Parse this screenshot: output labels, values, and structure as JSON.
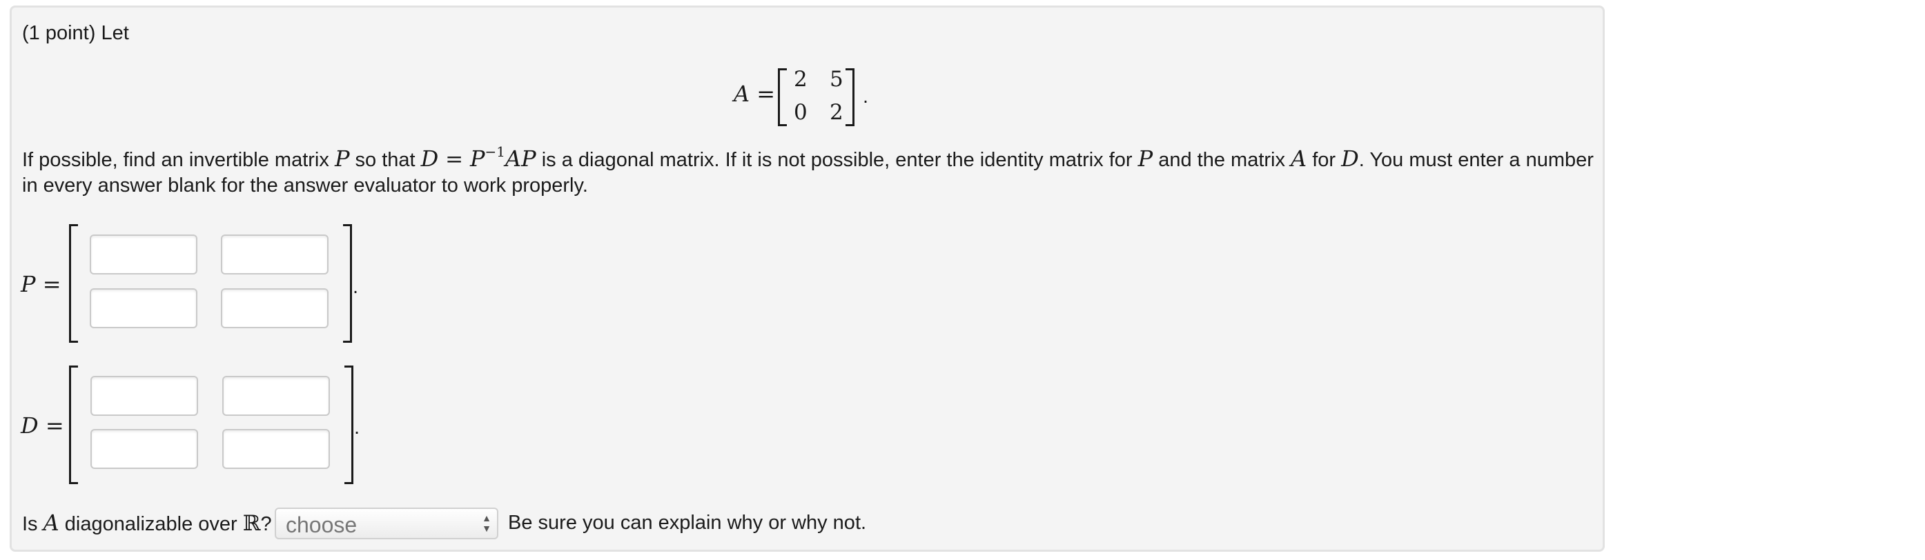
{
  "problem": {
    "intro": "(1 point) Let",
    "matrix_A": {
      "label": "A =",
      "rows": [
        [
          "2",
          "5"
        ],
        [
          "0",
          "2"
        ]
      ],
      "end": "."
    },
    "instructions": {
      "t1": "If possible, find an invertible matrix ",
      "P": "P",
      "t2": " so that ",
      "eq_D": "D",
      "eq_eq": " = ",
      "eq_P": "P",
      "eq_exp": "−1",
      "eq_AP": "AP",
      "t3": " is a diagonal matrix. If it is not possible, enter the identity matrix for ",
      "P2": "P",
      "t4": " and the matrix ",
      "A": "A",
      "t5": " for ",
      "D": "D",
      "t6": ". You must enter a number",
      "line2": "in every answer blank for the answer evaluator to work properly."
    },
    "P_answer": {
      "label": "P =",
      "cells": [
        "",
        "",
        "",
        ""
      ],
      "end": "."
    },
    "D_answer": {
      "label": "D =",
      "cells": [
        "",
        "",
        "",
        ""
      ],
      "end": "."
    },
    "question": {
      "t1": "Is ",
      "A": "A",
      "t2": " diagonalizable over ",
      "R": "ℝ",
      "t3": "?",
      "select_value": "choose",
      "after": "Be sure you can explain why or why not."
    }
  },
  "colors": {
    "panel_bg": "#f4f4f4",
    "panel_border": "#e2e2e2",
    "text": "#1a1a1a",
    "select_text": "#777777"
  }
}
